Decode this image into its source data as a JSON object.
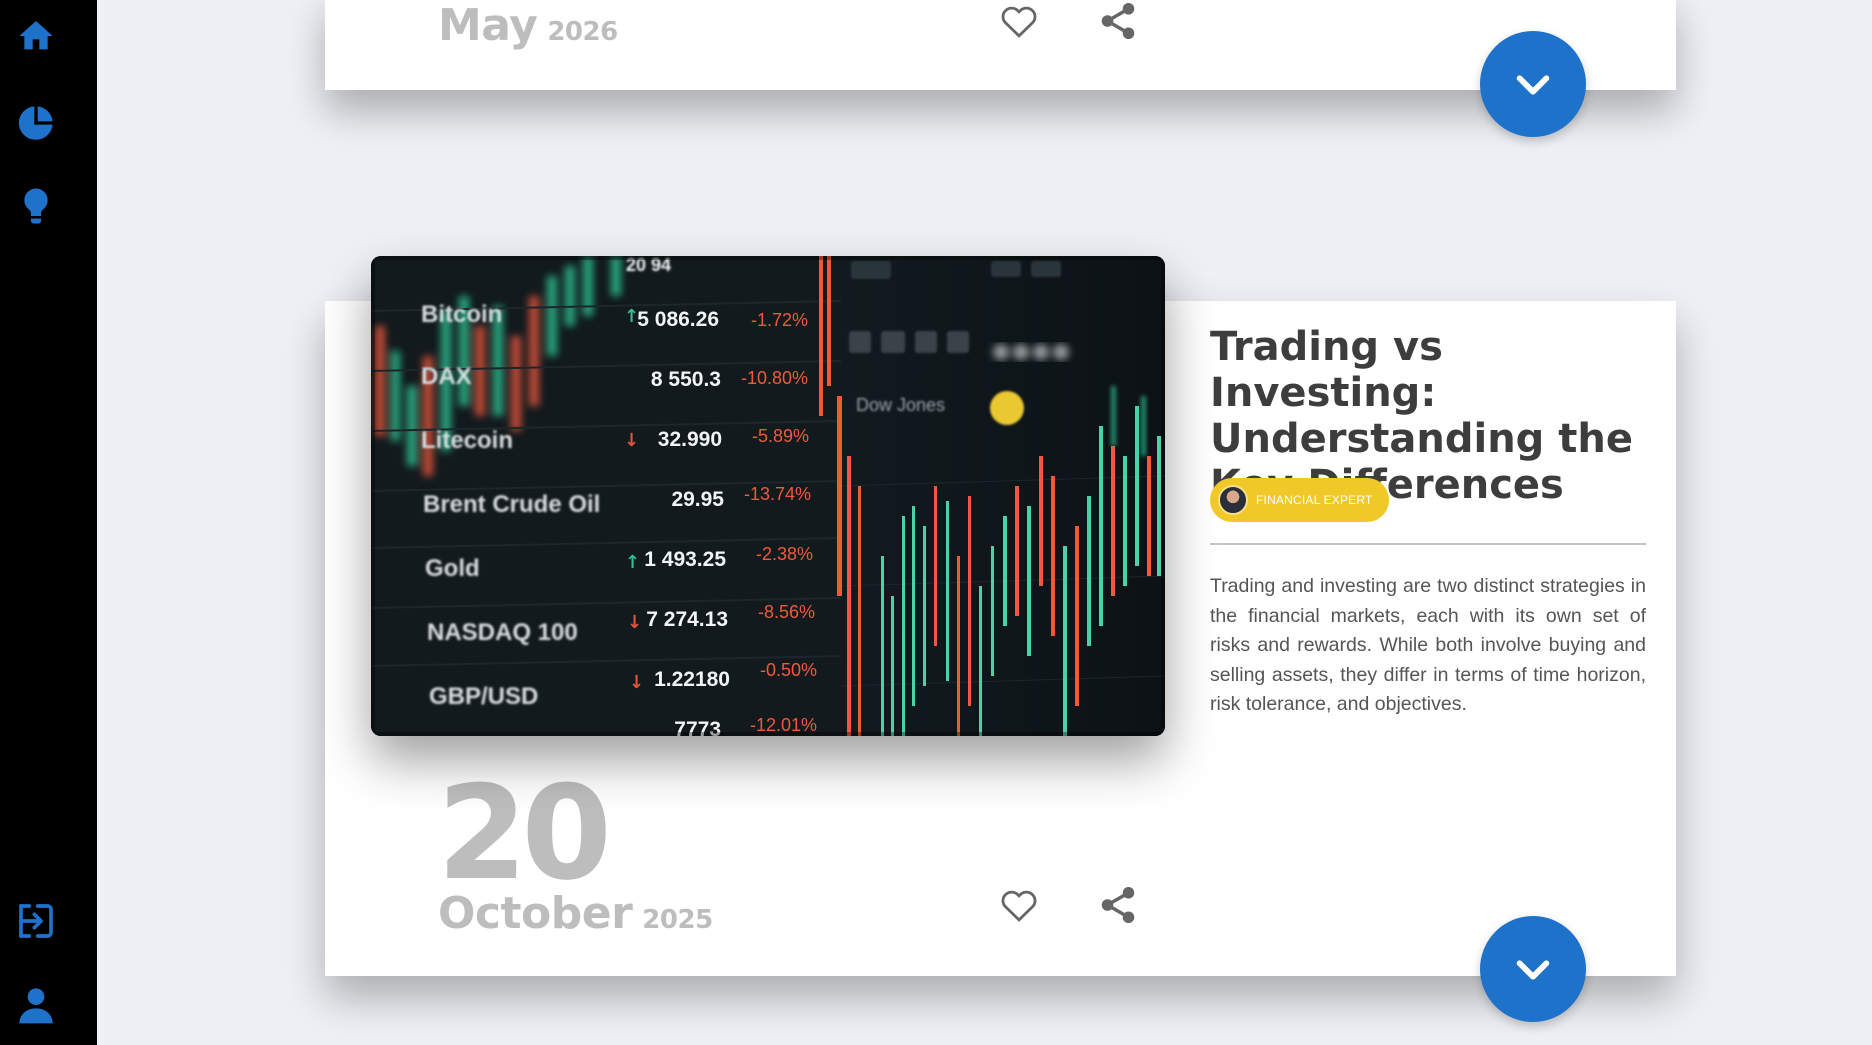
{
  "sidebar": {
    "items": [
      {
        "icon": "home-icon",
        "label": "Home"
      },
      {
        "icon": "pie-chart-icon",
        "label": "Portfolio"
      },
      {
        "icon": "lightbulb-icon",
        "label": "Ideas"
      }
    ],
    "bottom_items": [
      {
        "icon": "sign-in-icon",
        "label": "Login"
      },
      {
        "icon": "user-icon",
        "label": "Profile"
      }
    ]
  },
  "colors": {
    "accent": "#1f72c9",
    "badge": "#f0c928",
    "date_text": "#bdbdbd",
    "title_text": "#3d3d3d",
    "sidebar_bg": "#000000",
    "page_bg": "#eef0f5"
  },
  "posts": [
    {
      "month": "May",
      "year": "2026"
    },
    {
      "day": "20",
      "month": "October",
      "year": "2025",
      "title": "Trading vs Investing: Understanding the Key Differences",
      "author_role": "FINANCIAL EXPERT",
      "excerpt": "Trading and investing are two distinct strategies in the financial markets, each with its own set of risks and rewards. While both involve buying and selling assets, they differ in terms of time horizon, risk tolerance, and objectives.",
      "image": {
        "description_rows": [
          {
            "name": "Bitcoin",
            "arrow": "up",
            "value": "5 086.26",
            "change": "-1.72%"
          },
          {
            "name": "DAX",
            "arrow": "",
            "value": "8 550.3",
            "change": "-10.80%"
          },
          {
            "name": "Litecoin",
            "arrow": "down",
            "value": "32.990",
            "change": "-5.89%"
          },
          {
            "name": "Brent Crude Oil",
            "arrow": "",
            "value": "29.95",
            "change": "-13.74%"
          },
          {
            "name": "Gold",
            "arrow": "up",
            "value": "1 493.25",
            "change": "-2.38%"
          },
          {
            "name": "NASDAQ 100",
            "arrow": "down",
            "value": "7 274.13",
            "change": "-8.56%"
          },
          {
            "name": "GBP/USD",
            "arrow": "down",
            "value": "1.22180",
            "change": "-0.50%"
          }
        ],
        "partial_top": "20 94",
        "partial_bottom_value": "7773",
        "partial_bottom_change": "-12.01%",
        "chart_label": "Dow Jones"
      }
    }
  ]
}
